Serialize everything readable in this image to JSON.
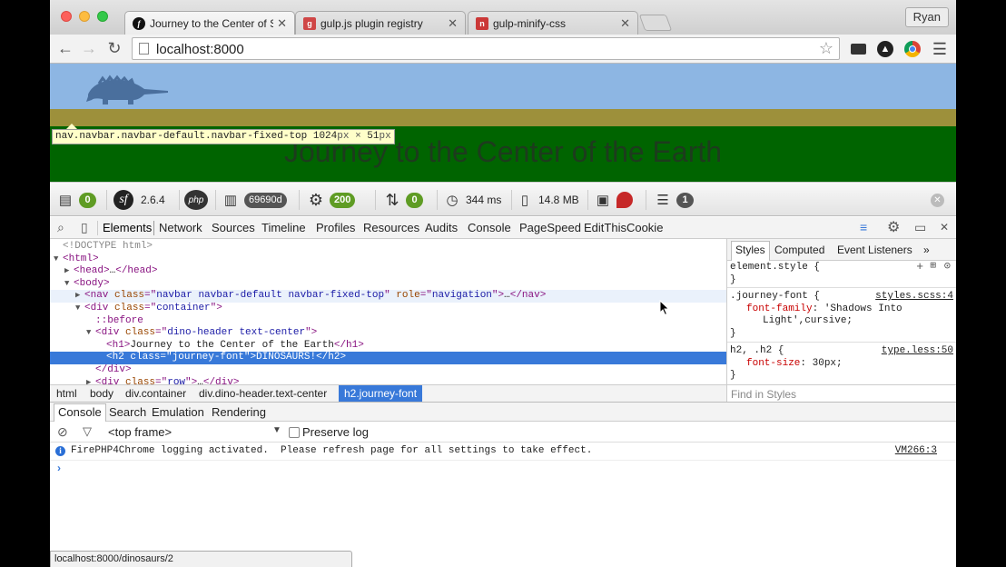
{
  "tabs": [
    {
      "title": "Journey to the Center of Sy",
      "active": true
    },
    {
      "title": "gulp.js plugin registry",
      "active": false
    },
    {
      "title": "gulp-minify-css",
      "active": false
    }
  ],
  "profile_name": "Ryan",
  "address_bar": {
    "url": "localhost:8000"
  },
  "page": {
    "heading": "Journey to the Center of the Earth",
    "inspect_tooltip": {
      "selector": "nav.navbar.navbar-default.navbar-fixed-top",
      "width": "1024",
      "height": "51",
      "unit": "px",
      "times": "×"
    }
  },
  "debug_toolbar": {
    "requests_count": "0",
    "symfony_version": "2.6.4",
    "php_badge": "php",
    "token": "69690d",
    "config_count": "200",
    "events_count": "0",
    "time": "344 ms",
    "memory": "14.8 MB",
    "list_count": "1"
  },
  "devtools": {
    "tabs": [
      "Elements",
      "Network",
      "Sources",
      "Timeline",
      "Profiles",
      "Resources",
      "Audits",
      "Console",
      "PageSpeed",
      "EditThisCookie"
    ],
    "active_tab": "Elements",
    "tree": [
      {
        "indent": 0,
        "tri": "",
        "parts": [
          [
            "cm",
            "<!DOCTYPE html>"
          ]
        ]
      },
      {
        "indent": 0,
        "tri": "▼",
        "parts": [
          [
            "tag",
            "<html>"
          ]
        ]
      },
      {
        "indent": 1,
        "tri": "▶",
        "parts": [
          [
            "tag",
            "<head>"
          ],
          [
            "",
            "…"
          ],
          [
            "tag",
            "</head>"
          ]
        ]
      },
      {
        "indent": 1,
        "tri": "▼",
        "parts": [
          [
            "tag",
            "<body>"
          ]
        ]
      },
      {
        "indent": 2,
        "tri": "▶",
        "parts": [
          [
            "tag",
            "<nav "
          ],
          [
            "an",
            "class"
          ],
          [
            "tag",
            "=\""
          ],
          [
            "av",
            "navbar navbar-default navbar-fixed-top"
          ],
          [
            "tag",
            "\" "
          ],
          [
            "an",
            "role"
          ],
          [
            "tag",
            "=\""
          ],
          [
            "av",
            "navigation"
          ],
          [
            "tag",
            "\">"
          ],
          [
            "",
            "…"
          ],
          [
            "tag",
            "</nav>"
          ]
        ]
      },
      {
        "indent": 2,
        "tri": "▼",
        "parts": [
          [
            "tag",
            "<div "
          ],
          [
            "an",
            "class"
          ],
          [
            "tag",
            "=\""
          ],
          [
            "av",
            "container"
          ],
          [
            "tag",
            "\">"
          ]
        ]
      },
      {
        "indent": 3,
        "tri": "",
        "parts": [
          [
            "pe",
            "::before"
          ]
        ]
      },
      {
        "indent": 3,
        "tri": "▼",
        "parts": [
          [
            "tag",
            "<div "
          ],
          [
            "an",
            "class"
          ],
          [
            "tag",
            "=\""
          ],
          [
            "av",
            "dino-header text-center"
          ],
          [
            "tag",
            "\">"
          ]
        ]
      },
      {
        "indent": 4,
        "tri": "",
        "parts": [
          [
            "tag",
            "<h1>"
          ],
          [
            "",
            "Journey to the Center of the Earth"
          ],
          [
            "tag",
            "</h1>"
          ]
        ]
      },
      {
        "indent": 4,
        "tri": "",
        "parts": [
          [
            "tag",
            "<h2 "
          ],
          [
            "an",
            "class"
          ],
          [
            "tag",
            "=\""
          ],
          [
            "av",
            "journey-font"
          ],
          [
            "tag",
            "\">"
          ],
          [
            "",
            "DINOSAURS!"
          ],
          [
            "tag",
            "</h2>"
          ]
        ]
      },
      {
        "indent": 3,
        "tri": "",
        "parts": [
          [
            "tag",
            "</div>"
          ]
        ]
      },
      {
        "indent": 3,
        "tri": "▶",
        "parts": [
          [
            "tag",
            "<div "
          ],
          [
            "an",
            "class"
          ],
          [
            "tag",
            "=\""
          ],
          [
            "av",
            "row"
          ],
          [
            "tag",
            "\">"
          ],
          [
            "",
            "…"
          ],
          [
            "tag",
            "</div>"
          ]
        ]
      }
    ],
    "breadcrumbs": [
      "html",
      "body",
      "div.container",
      "div.dino-header.text-center",
      "h2.journey-font"
    ],
    "styles_tabs": [
      "Styles",
      "Computed",
      "Event Listeners",
      "»"
    ],
    "styles": {
      "element_style": "element.style {",
      "rule1_selector": ".journey-font {",
      "rule1_source": "styles.scss:4",
      "rule1_prop": "font-family",
      "rule1_value": "'Shadows Into",
      "rule1_value2": "Light',cursive;",
      "rule2_selector": "h2, .h2 {",
      "rule2_source": "type.less:50",
      "rule2_prop": "font-size",
      "rule2_value": "30px;",
      "close_brace": "}",
      "find_placeholder": "Find in Styles"
    },
    "drawer_tabs": [
      "Console",
      "Search",
      "Emulation",
      "Rendering"
    ],
    "console": {
      "frame": "<top frame>",
      "preserve_log": "Preserve log",
      "message": "FirePHP4Chrome logging activated.  Please refresh page for all settings to take effect.",
      "message_source": "VM266:3",
      "prompt": "›"
    }
  },
  "status_bar": "localhost:8000/dinosaurs/2",
  "colors": {
    "sky": "#8db6e3",
    "dirt": "#9d903b",
    "grass": "#006400",
    "selection": "#3879d9",
    "badge_green": "#5f9c24"
  }
}
